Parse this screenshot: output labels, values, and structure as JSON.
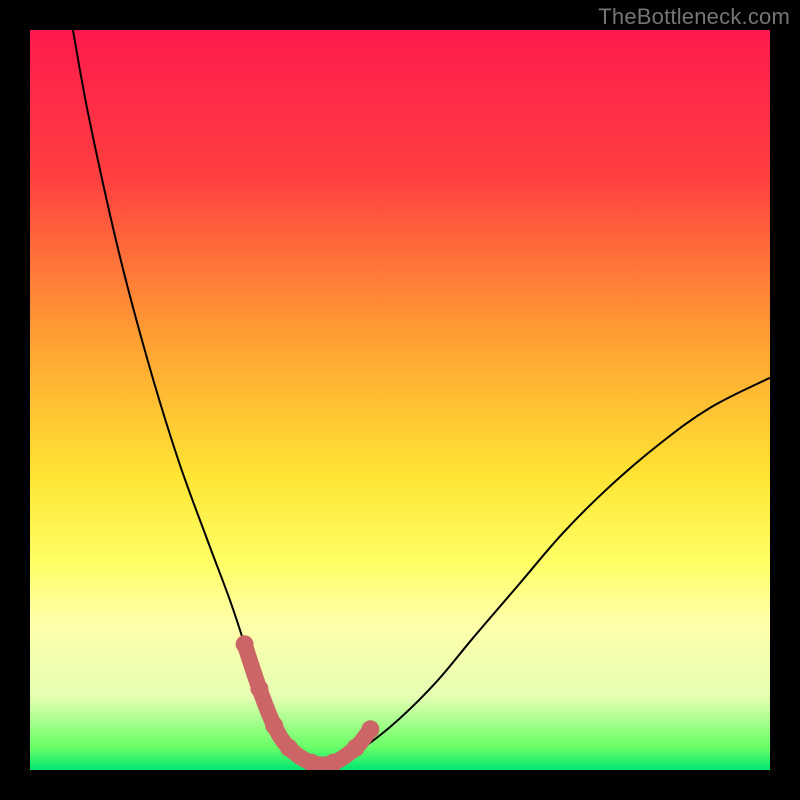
{
  "watermark": "TheBottleneck.com",
  "colors": {
    "frame_bg": "#000000",
    "watermark_text": "#757575",
    "curve_stroke": "#000000",
    "marker": "#cc6666",
    "gradient_stops": [
      {
        "offset": 0.0,
        "color": "#ff1a4d"
      },
      {
        "offset": 0.2,
        "color": "#ff4040"
      },
      {
        "offset": 0.4,
        "color": "#ff9933"
      },
      {
        "offset": 0.6,
        "color": "#ffe433"
      },
      {
        "offset": 0.72,
        "color": "#ffff66"
      },
      {
        "offset": 0.8,
        "color": "#ffffaa"
      },
      {
        "offset": 0.9,
        "color": "#e6ffb3"
      },
      {
        "offset": 0.97,
        "color": "#66ff66"
      },
      {
        "offset": 1.0,
        "color": "#00e673"
      }
    ]
  },
  "chart_data": {
    "type": "line",
    "title": "",
    "xlabel": "",
    "ylabel": "",
    "xlim": [
      0,
      100
    ],
    "ylim": [
      0,
      100
    ],
    "series": [
      {
        "name": "bottleneck-curve",
        "x": [
          5.8,
          8,
          12,
          16,
          20,
          24,
          27,
          29,
          31,
          33,
          35,
          38,
          41,
          45,
          50,
          55,
          60,
          66,
          72,
          78,
          85,
          92,
          100
        ],
        "values": [
          100,
          88,
          70,
          55,
          42,
          31,
          23,
          17,
          11,
          6,
          3,
          1,
          1,
          3,
          7,
          12,
          18,
          25,
          32,
          38,
          44,
          49,
          53
        ]
      }
    ],
    "markers": {
      "name": "highlighted-range",
      "x": [
        29,
        31,
        33,
        35,
        38,
        41,
        44,
        46
      ],
      "values": [
        17,
        11,
        6,
        3,
        1,
        1,
        3,
        5.5
      ]
    }
  }
}
